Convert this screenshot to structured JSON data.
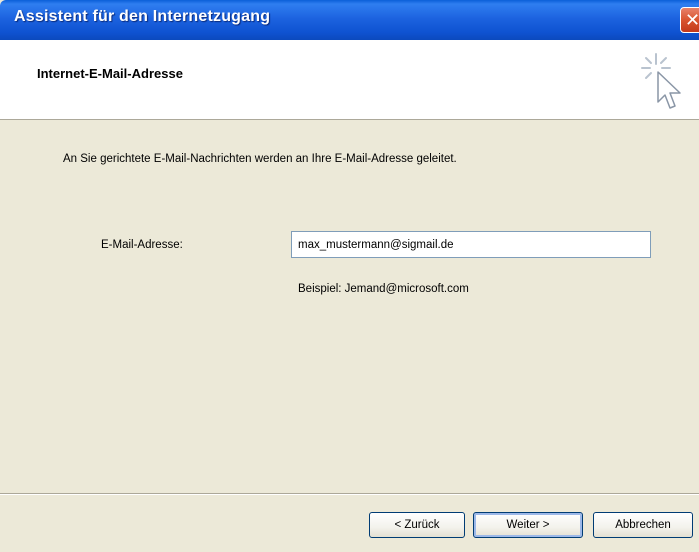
{
  "window": {
    "title": "Assistent für den Internetzugang"
  },
  "header": {
    "title": "Internet-E-Mail-Adresse"
  },
  "main": {
    "description": "An Sie gerichtete E-Mail-Nachrichten werden an Ihre E-Mail-Adresse geleitet.",
    "email_label": "E-Mail-Adresse:",
    "email_value": "max_mustermann@sigmail.de",
    "example": "Beispiel: Jemand@microsoft.com"
  },
  "footer": {
    "back_label": "< Zurück",
    "next_label": "Weiter >",
    "cancel_label": "Abbrechen"
  },
  "colors": {
    "titlebar": "#0f53d2",
    "dialog_bg": "#ece9d8",
    "close_button": "#d9542f"
  },
  "icons": {
    "close": "close-icon",
    "wizard": "wizard-cursor-icon"
  }
}
